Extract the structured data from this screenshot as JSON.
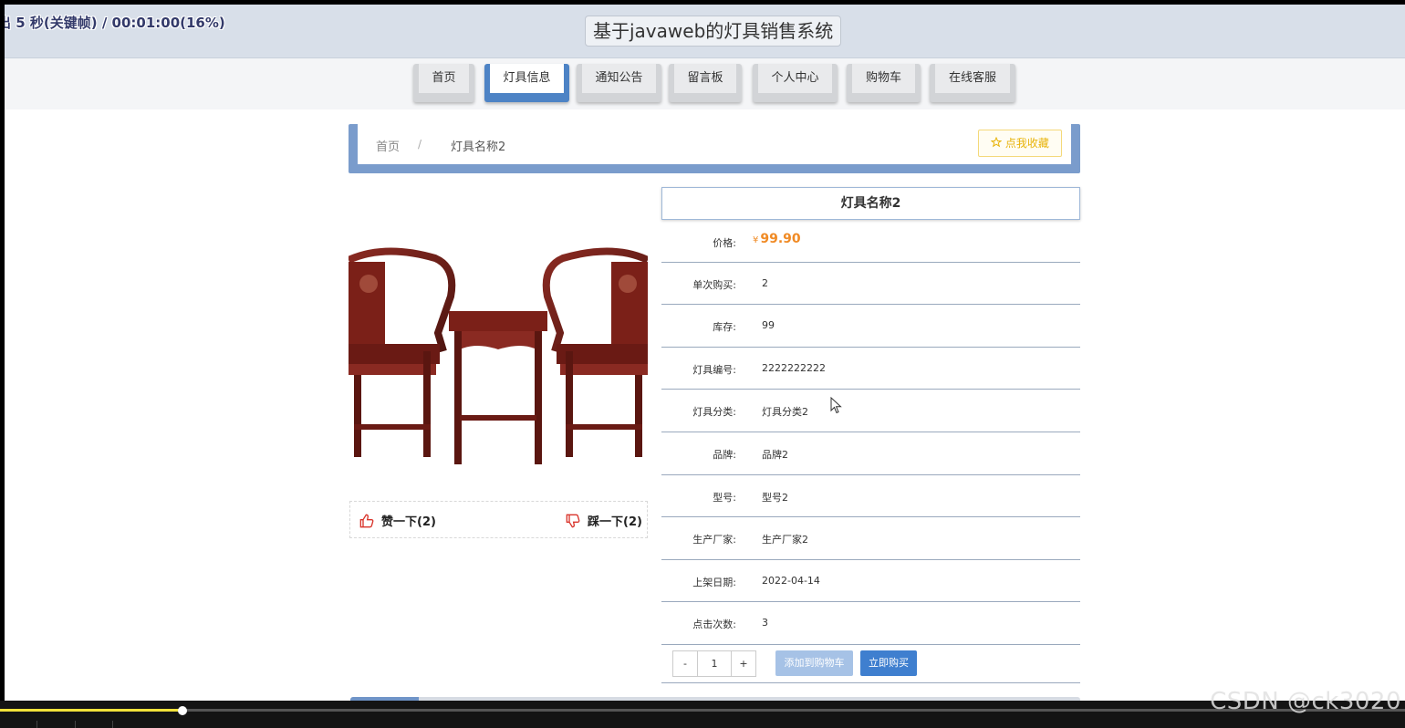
{
  "overlay": {
    "text": "出 5 秒(关键帧) / 00:01:00(16%)"
  },
  "header": {
    "title": "基于javaweb的灯具销售系统"
  },
  "nav": {
    "items": [
      {
        "label": "首页"
      },
      {
        "label": "灯具信息",
        "active": true
      },
      {
        "label": "通知公告"
      },
      {
        "label": "留言板"
      },
      {
        "label": "个人中心"
      },
      {
        "label": "购物车"
      },
      {
        "label": "在线客服"
      }
    ]
  },
  "breadcrumb": {
    "home": "首页",
    "separator": "/",
    "current": "灯具名称2",
    "favorite_label": "点我收藏"
  },
  "product": {
    "name": "灯具名称2",
    "image_alt": "chairs-and-table-icon",
    "price_label": "价格:",
    "price_currency": "¥",
    "price": "99.90",
    "rows": [
      {
        "label": "单次购买:",
        "value": "2"
      },
      {
        "label": "库存:",
        "value": "99"
      },
      {
        "label": "灯具编号:",
        "value": "2222222222"
      },
      {
        "label": "灯具分类:",
        "value": "灯具分类2"
      },
      {
        "label": "品牌:",
        "value": "品牌2"
      },
      {
        "label": "型号:",
        "value": "型号2"
      },
      {
        "label": "生产厂家:",
        "value": "生产厂家2"
      },
      {
        "label": "上架日期:",
        "value": "2022-04-14"
      },
      {
        "label": "点击次数:",
        "value": "3"
      }
    ]
  },
  "votes": {
    "up_label": "赞一下(2)",
    "down_label": "踩一下(2)"
  },
  "purchase": {
    "minus": "-",
    "quantity": "1",
    "plus": "+",
    "add_cart_label": "添加到购物车",
    "buy_now_label": "立即购买"
  },
  "video": {
    "progress": 0.13
  },
  "watermark": {
    "text": "CSDN @ck3020"
  },
  "colors": {
    "accent": "#4d83c5",
    "price": "#f08a24",
    "favorite": "#e8b40c",
    "vote_icon": "#d9342b"
  }
}
